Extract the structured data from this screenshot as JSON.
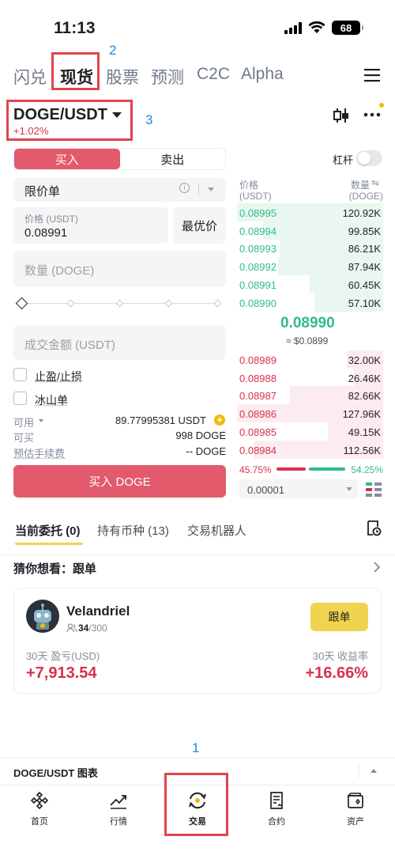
{
  "status_bar": {
    "time": "11:13",
    "battery": "68"
  },
  "top_nav": {
    "tabs": [
      "闪兑",
      "现货",
      "股票",
      "预测",
      "C2C",
      "Alpha"
    ],
    "annotation": "2"
  },
  "pair": {
    "name": "DOGE/USDT",
    "change": "+1.02%",
    "annotation": "3"
  },
  "order_form": {
    "buy_label": "买入",
    "sell_label": "卖出",
    "order_type": "限价单",
    "price_label": "价格 (USDT)",
    "price_value": "0.08991",
    "best_price": "最优价",
    "qty_placeholder": "数量 (DOGE)",
    "amount_placeholder": "成交金额 (USDT)",
    "tp_sl": "止盈/止损",
    "iceberg": "冰山单",
    "available_label": "可用",
    "available_value": "89.77995381 USDT",
    "can_buy_label": "可买",
    "can_buy_value": "998 DOGE",
    "fee_label": "预估手续费",
    "fee_value": "-- DOGE",
    "submit": "买入 DOGE"
  },
  "leverage_label": "杠杆",
  "order_book": {
    "price_header": "价格",
    "price_unit": "(USDT)",
    "qty_header": "数量",
    "qty_unit": "(DOGE)",
    "bids": [
      {
        "price": "0.08995",
        "qty": "120.92K",
        "depth": 1.0
      },
      {
        "price": "0.08994",
        "qty": "99.85K",
        "depth": 0.82
      },
      {
        "price": "0.08993",
        "qty": "86.21K",
        "depth": 0.71
      },
      {
        "price": "0.08992",
        "qty": "87.94K",
        "depth": 0.72
      },
      {
        "price": "0.08991",
        "qty": "60.45K",
        "depth": 0.5
      },
      {
        "price": "0.08990",
        "qty": "57.10K",
        "depth": 0.47
      }
    ],
    "mid_price": "0.08990",
    "mid_usd": "≈ $0.0899",
    "asks": [
      {
        "price": "0.08989",
        "qty": "32.00K",
        "depth": 0.25
      },
      {
        "price": "0.08988",
        "qty": "26.46K",
        "depth": 0.2
      },
      {
        "price": "0.08987",
        "qty": "82.66K",
        "depth": 0.64
      },
      {
        "price": "0.08986",
        "qty": "127.96K",
        "depth": 1.0
      },
      {
        "price": "0.08985",
        "qty": "49.15K",
        "depth": 0.38
      },
      {
        "price": "0.08984",
        "qty": "112.56K",
        "depth": 0.88
      }
    ],
    "buy_ratio": "45.75%",
    "sell_ratio": "54.25%",
    "precision": "0.00001"
  },
  "orders_tabs": [
    "当前委托 (0)",
    "持有币种 (13)",
    "交易机器人"
  ],
  "guess": {
    "title": "猜你想看：跟单"
  },
  "copy_trader": {
    "name": "Velandriel",
    "followers": "34",
    "followers_max": "/300",
    "follow_button": "跟单",
    "pnl_label": "30天 盈亏(USD)",
    "pnl_value": "+7,913.54",
    "roi_label": "30天 收益率",
    "roi_value": "+16.66%"
  },
  "chart_bar": {
    "label": "DOGE/USDT 图表",
    "annotation": "1"
  },
  "bottom_nav": [
    "首页",
    "行情",
    "交易",
    "合约",
    "资产"
  ],
  "colors": {
    "accent_red": "#e25a6c",
    "green": "#2ebd85",
    "yellow": "#f0d34f",
    "highlight": "#e0454f",
    "annotation_blue": "#1e88e5"
  }
}
